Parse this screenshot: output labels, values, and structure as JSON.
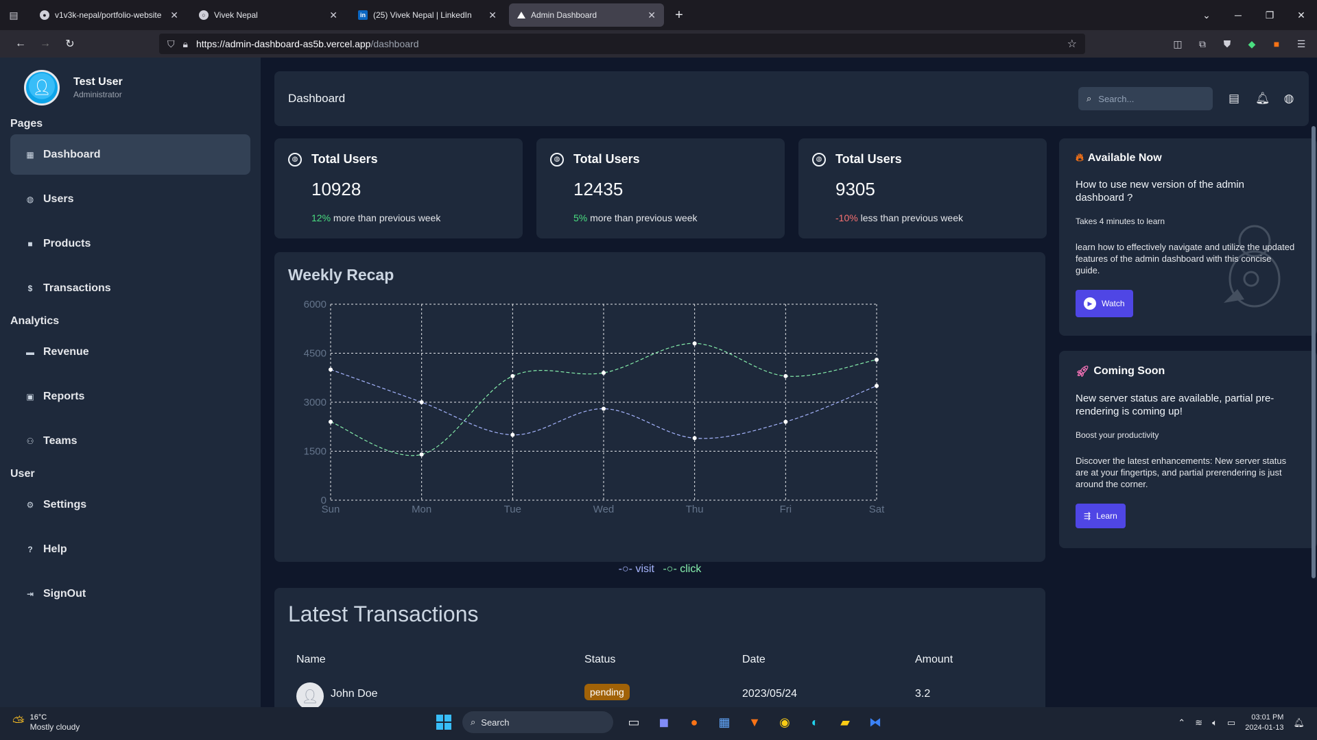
{
  "browser": {
    "tabs": [
      {
        "title": "v1v3k-nepal/portfolio-website",
        "icon": "github-icon",
        "active": false
      },
      {
        "title": "Vivek Nepal",
        "icon": "globe-icon",
        "active": false
      },
      {
        "title": "(25) Vivek Nepal | LinkedIn",
        "icon": "linkedin-icon",
        "active": false
      },
      {
        "title": "Admin Dashboard",
        "icon": "vercel-icon",
        "active": true
      }
    ],
    "url_host": "https://admin-dashboard-as5b.vercel.app",
    "url_path": "/dashboard"
  },
  "sidebar": {
    "user_name": "Test User",
    "user_role": "Administrator",
    "sections": [
      {
        "title": "Pages",
        "items": [
          {
            "label": "Dashboard",
            "icon": "grid-icon",
            "active": true
          },
          {
            "label": "Users",
            "icon": "globe-icon",
            "active": false
          },
          {
            "label": "Products",
            "icon": "bag-icon",
            "active": false
          },
          {
            "label": "Transactions",
            "icon": "dollar-icon",
            "active": false
          }
        ]
      },
      {
        "title": "Analytics",
        "items": [
          {
            "label": "Revenue",
            "icon": "briefcase-icon",
            "active": false
          },
          {
            "label": "Reports",
            "icon": "report-icon",
            "active": false
          },
          {
            "label": "Teams",
            "icon": "team-icon",
            "active": false
          }
        ]
      },
      {
        "title": "User",
        "items": [
          {
            "label": "Settings",
            "icon": "gear-icon",
            "active": false
          },
          {
            "label": "Help",
            "icon": "help-icon",
            "active": false
          },
          {
            "label": "SignOut",
            "icon": "signout-icon",
            "active": false
          }
        ]
      }
    ]
  },
  "header": {
    "title": "Dashboard",
    "search_placeholder": "Search..."
  },
  "stats": [
    {
      "title": "Total Users",
      "value": "10928",
      "delta": "12%",
      "delta_color": "#4ade80",
      "note": "more than previous week"
    },
    {
      "title": "Total Users",
      "value": "12435",
      "delta": "5%",
      "delta_color": "#4ade80",
      "note": "more than previous week"
    },
    {
      "title": "Total Users",
      "value": "9305",
      "delta": "-10%",
      "delta_color": "#f87171",
      "note": "less than previous week"
    }
  ],
  "chart_data": {
    "type": "line",
    "title": "Weekly Recap",
    "categories": [
      "Sun",
      "Mon",
      "Tue",
      "Wed",
      "Thu",
      "Fri",
      "Sat"
    ],
    "ylim": [
      0,
      6000
    ],
    "yticks": [
      0,
      1500,
      3000,
      4500,
      6000
    ],
    "grid": true,
    "legend_position": "bottom",
    "series": [
      {
        "name": "visit",
        "color": "#a5b4fc",
        "values": [
          4000,
          3000,
          2000,
          2800,
          1900,
          2400,
          3500
        ]
      },
      {
        "name": "click",
        "color": "#86efac",
        "values": [
          2400,
          1400,
          3800,
          3900,
          4800,
          3800,
          4300
        ]
      }
    ]
  },
  "transactions": {
    "title": "Latest Transactions",
    "columns": [
      "Name",
      "Status",
      "Date",
      "Amount"
    ],
    "rows": [
      {
        "name": "John Doe",
        "status": "pending",
        "date": "2023/05/24",
        "amount": "3.2"
      }
    ]
  },
  "cards": [
    {
      "title": "Available Now",
      "icon": "fire-icon",
      "main": "How to use new version of the admin dashboard ?",
      "sub": "Takes 4 minutes to learn",
      "body": "learn how to effectively navigate and utilize the updated features of the admin dashboard with this concise guide.",
      "button": "Watch"
    },
    {
      "title": "Coming Soon",
      "icon": "rocket-icon",
      "main": "New server status are available, partial pre-rendering is coming up!",
      "sub": "Boost your productivity",
      "body": "Discover the latest enhancements: New server status are at your fingertips, and partial prerendering is just around the corner.",
      "button": "Learn"
    }
  ],
  "taskbar": {
    "temp": "16°C",
    "weather": "Mostly cloudy",
    "search": "Search",
    "time": "03:01 PM",
    "date": "2024-01-13"
  }
}
